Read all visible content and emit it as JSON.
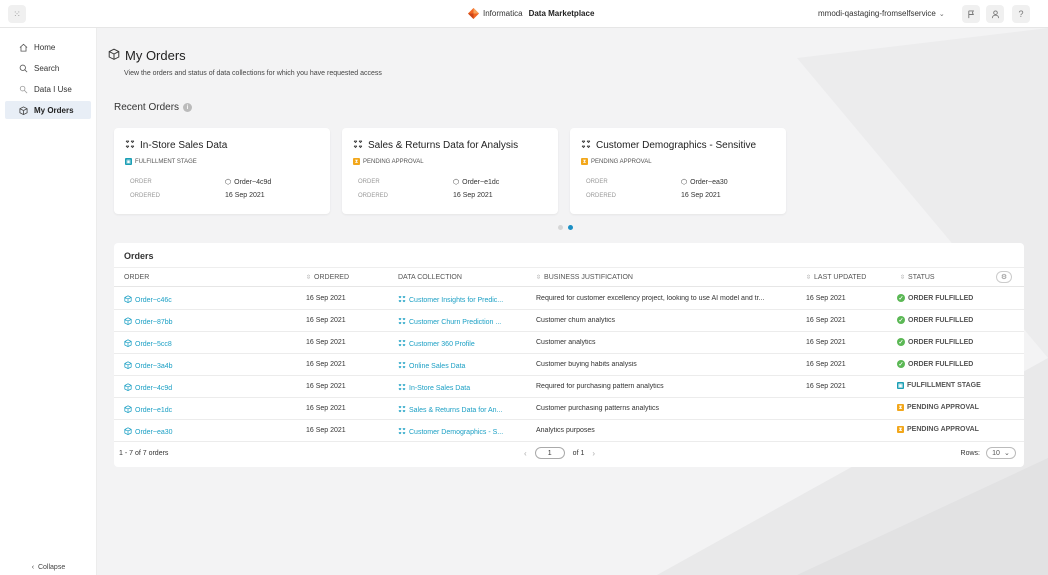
{
  "header": {
    "brand_name": "Informatica",
    "product_name": "Data Marketplace",
    "org_name": "mmodi-qastaging-fromselfservice"
  },
  "sidebar": {
    "items": [
      {
        "label": "Home",
        "icon": "home-icon"
      },
      {
        "label": "Search",
        "icon": "search-icon"
      },
      {
        "label": "Data I Use",
        "icon": "data-search-icon"
      },
      {
        "label": "My Orders",
        "icon": "package-icon",
        "active": true
      }
    ],
    "collapse_label": "Collapse"
  },
  "page": {
    "title": "My Orders",
    "subtitle": "View the orders and status of data collections for which you have requested access"
  },
  "recent": {
    "title": "Recent Orders",
    "order_label": "ORDER",
    "ordered_label": "ORDERED",
    "cards": [
      {
        "title": "In-Store Sales Data",
        "status": "FULFILLMENT STAGE",
        "status_color": "#1b9fb5",
        "order": "Order~4c9d",
        "ordered": "16 Sep 2021"
      },
      {
        "title": "Sales & Returns Data for Analysis",
        "status": "PENDING APPROVAL",
        "status_color": "#f2a71b",
        "order": "Order~e1dc",
        "ordered": "16 Sep 2021"
      },
      {
        "title": "Customer Demographics - Sensitive",
        "status": "PENDING APPROVAL",
        "status_color": "#f2a71b",
        "order": "Order~ea30",
        "ordered": "16 Sep 2021"
      }
    ]
  },
  "orders": {
    "title": "Orders",
    "columns": [
      "ORDER",
      "ORDERED",
      "DATA COLLECTION",
      "BUSINESS JUSTIFICATION",
      "LAST UPDATED",
      "STATUS"
    ],
    "rows": [
      {
        "order": "Order~c46c",
        "ordered": "16 Sep 2021",
        "collection": "Customer Insights for Predic...",
        "justification": "Required for customer excellency project, looking to use AI model and tr...",
        "updated": "16 Sep 2021",
        "status": "ORDER FULFILLED",
        "status_type": "fulfilled"
      },
      {
        "order": "Order~87bb",
        "ordered": "16 Sep 2021",
        "collection": "Customer Churn Prediction ...",
        "justification": "Customer churn analytics",
        "updated": "16 Sep 2021",
        "status": "ORDER FULFILLED",
        "status_type": "fulfilled"
      },
      {
        "order": "Order~5cc8",
        "ordered": "16 Sep 2021",
        "collection": "Customer 360 Profile",
        "justification": "Customer analytics",
        "updated": "16 Sep 2021",
        "status": "ORDER FULFILLED",
        "status_type": "fulfilled"
      },
      {
        "order": "Order~3a4b",
        "ordered": "16 Sep 2021",
        "collection": "Online Sales Data",
        "justification": "Customer buying habits analysis",
        "updated": "16 Sep 2021",
        "status": "ORDER FULFILLED",
        "status_type": "fulfilled"
      },
      {
        "order": "Order~4c9d",
        "ordered": "16 Sep 2021",
        "collection": "In-Store Sales Data",
        "justification": "Required for purchasing pattern analytics",
        "updated": "16 Sep 2021",
        "status": "FULFILLMENT STAGE",
        "status_type": "fulfillment"
      },
      {
        "order": "Order~e1dc",
        "ordered": "16 Sep 2021",
        "collection": "Sales & Returns Data for An...",
        "justification": "Customer purchasing patterns analytics",
        "updated": "",
        "status": "PENDING APPROVAL",
        "status_type": "pending"
      },
      {
        "order": "Order~ea30",
        "ordered": "16 Sep 2021",
        "collection": "Customer Demographics - S...",
        "justification": "Analytics purposes",
        "updated": "",
        "status": "PENDING APPROVAL",
        "status_type": "pending"
      }
    ],
    "pagination": {
      "summary": "1 - 7 of 7 orders",
      "current_page": "1",
      "of_pages": "of 1",
      "rows_label": "Rows:",
      "rows_value": "10"
    }
  },
  "colors": {
    "accent": "#1a9fc4",
    "fulfilled": "#5bb855",
    "fulfillment": "#1b9fb5",
    "pending": "#f2a71b",
    "brand_orange": "#f26522"
  }
}
